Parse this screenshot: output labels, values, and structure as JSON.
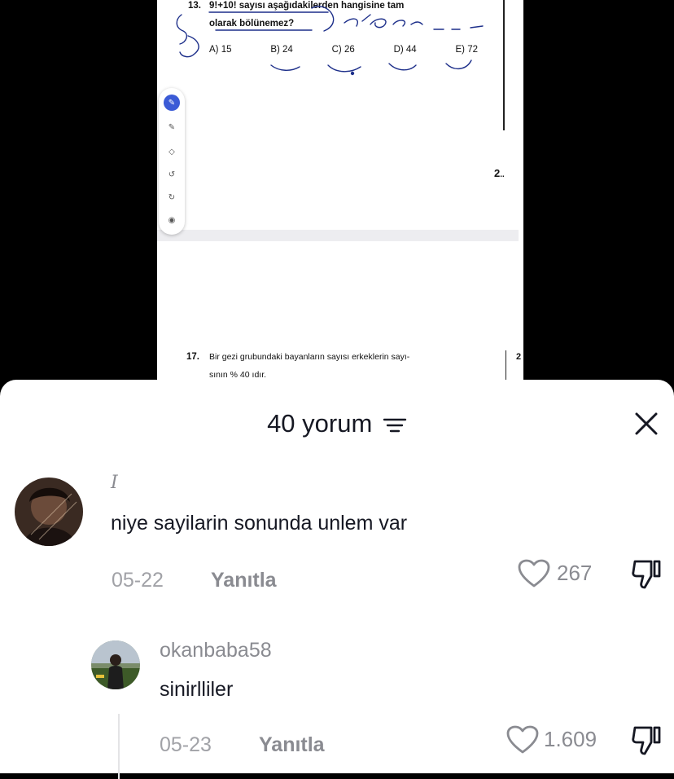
{
  "exam": {
    "q13_number": "13.",
    "q13_line1": "9!+10! sayısı aşağıdakilerden hangisine tam",
    "q13_line2": "olarak bölünemez?",
    "options": [
      "A) 15",
      "B) 24",
      "C) 26",
      "D) 44",
      "E) 72"
    ],
    "q17_number": "17.",
    "q17_line1": "Bir gezi grubundaki bayanların sayısı erkeklerin sayı-",
    "q17_line2": "sının % 40 ıdır.",
    "side_number_1": "2",
    "side_number_2": "2"
  },
  "comments_panel": {
    "title": "40 yorum",
    "comments": [
      {
        "username": "I",
        "text": "niye sayilarin sonunda unlem var",
        "date": "05-22",
        "reply_label": "Yanıtla",
        "likes": "267"
      },
      {
        "username": "okanbaba58",
        "text": "sinirlliler",
        "date": "05-23",
        "reply_label": "Yanıtla",
        "likes": "1.609"
      }
    ]
  },
  "colors": {
    "panel_bg": "#ffffff",
    "primary_text": "#161823",
    "secondary_text": "#8a8b91",
    "date_text": "#a1a2a7",
    "tool_accent": "#3b5bd6"
  }
}
